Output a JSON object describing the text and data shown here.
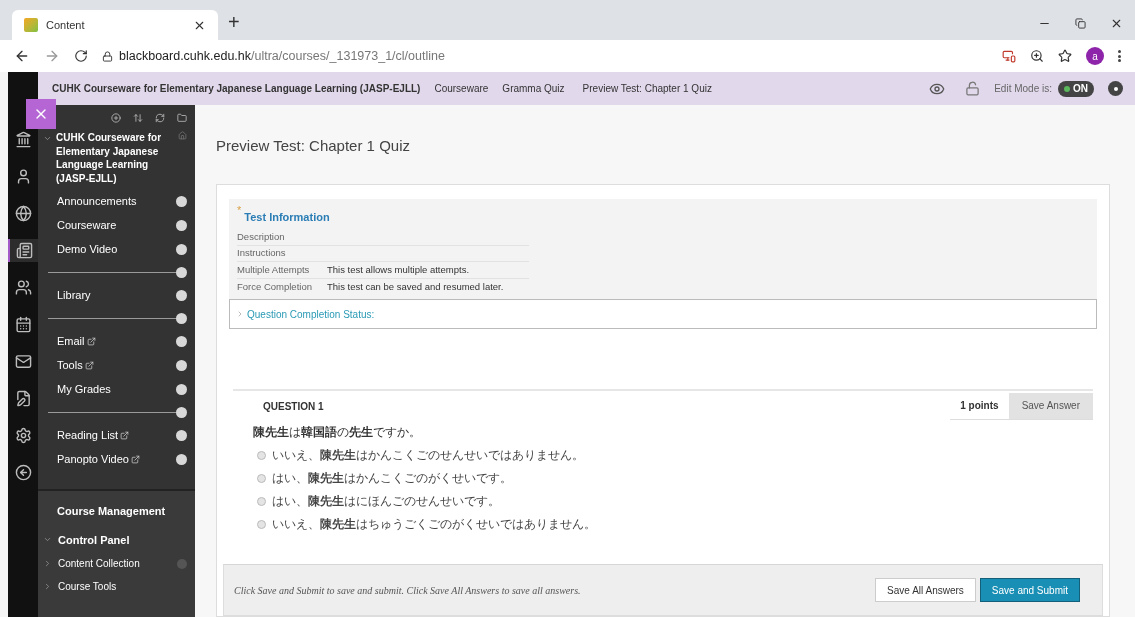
{
  "browser": {
    "tab_title": "Content",
    "new_tab": "+",
    "url_host": "blackboard.cuhk.edu.hk",
    "url_path": "/ultra/courses/_131973_1/cl/outline",
    "profile_initial": "a"
  },
  "breadcrumb": {
    "items": [
      {
        "label": "CUHK Courseware for Elementary Japanese Language Learning (JASP-EJLL)",
        "kind": "course"
      },
      {
        "label": "Courseware",
        "kind": "link"
      },
      {
        "label": "Gramma Quiz",
        "kind": "link"
      },
      {
        "label": "Preview Test: Chapter 1 Quiz",
        "kind": "current"
      }
    ],
    "edit_mode_label": "Edit Mode is:",
    "edit_mode": {
      "on": true,
      "label": "ON"
    }
  },
  "course_menu": {
    "title": "CUHK Courseware for Elementary Japanese Language Learning (JASP-EJLL)",
    "expanded": true,
    "items": [
      {
        "kind": "link",
        "label": "Announcements",
        "external": false
      },
      {
        "kind": "link",
        "label": "Courseware",
        "external": false
      },
      {
        "kind": "link",
        "label": "Demo Video",
        "external": false
      },
      {
        "kind": "divider"
      },
      {
        "kind": "link",
        "label": "Library",
        "external": false
      },
      {
        "kind": "divider"
      },
      {
        "kind": "link",
        "label": "Email",
        "external": true
      },
      {
        "kind": "link",
        "label": "Tools",
        "external": true
      },
      {
        "kind": "link",
        "label": "My Grades",
        "external": false
      },
      {
        "kind": "divider"
      },
      {
        "kind": "link",
        "label": "Reading List",
        "external": true
      },
      {
        "kind": "link",
        "label": "Panopto Video",
        "external": true
      }
    ],
    "management": {
      "title": "Course Management",
      "panel": {
        "label": "Control Panel",
        "expanded": true
      },
      "children": [
        {
          "label": "Content Collection",
          "expanded": false
        },
        {
          "label": "Course Tools",
          "expanded": false
        }
      ]
    }
  },
  "page": {
    "title": "Preview Test: Chapter 1 Quiz",
    "test_info": {
      "required_mark": "*",
      "title": "Test Information",
      "rows": [
        {
          "label": "Description"
        },
        {
          "label": "Instructions"
        },
        {
          "label": "Multiple Attempts",
          "value": "This test allows multiple attempts."
        },
        {
          "label": "Force Completion",
          "value": "This test can be saved and resumed later."
        }
      ]
    },
    "completion_status": {
      "label": "Question Completion Status:",
      "expanded": false
    },
    "question": {
      "number": "QUESTION 1",
      "points": "1 points",
      "save_button": "Save Answer",
      "text": "**陳先生**は**韓国語**の**先生**ですか。",
      "options": [
        {
          "text": "いいえ、**陳先生**はかんこくごのせんせいではありません。",
          "selected": false
        },
        {
          "text": "はい、**陳先生**はかんこくごのがくせいです。",
          "selected": false
        },
        {
          "text": "はい、**陳先生**はにほんごのせんせいです。",
          "selected": false
        },
        {
          "text": "いいえ、**陳先生**はちゅうごくごのがくせいではありません。",
          "selected": false
        }
      ]
    },
    "footer": {
      "hint": "Click Save and Submit to save and submit. Click Save All Answers to save all answers.",
      "buttons": [
        {
          "label": "Save All Answers",
          "kind": "secondary"
        },
        {
          "label": "Save and Submit",
          "kind": "primary"
        }
      ]
    }
  }
}
